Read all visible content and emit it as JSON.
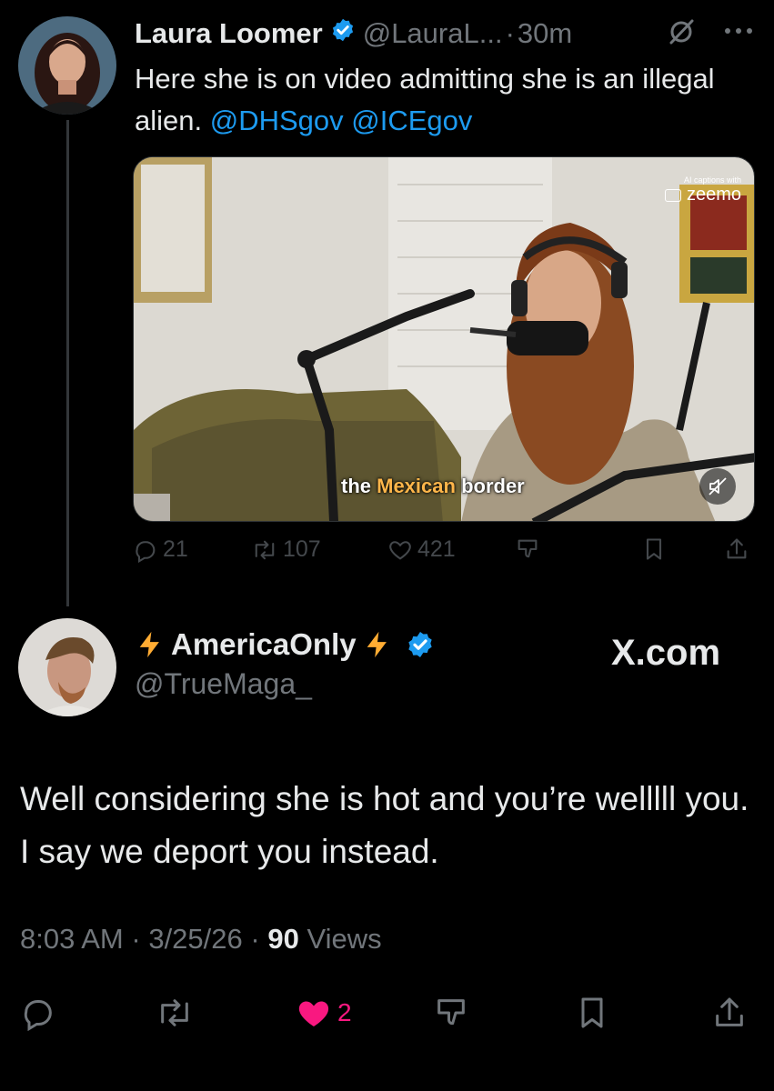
{
  "tweet1": {
    "author_name": "Laura Loomer",
    "handle": "@LauraL...",
    "separator": "·",
    "time": "30m",
    "text_plain": "Here she is on video admitting she is an illegal alien. ",
    "mention1": "@DHSgov",
    "mention2": "@ICEgov",
    "media": {
      "caption_pre": "the ",
      "caption_highlight": "Mexican",
      "caption_post": " border",
      "watermark_small": "AI captions with",
      "watermark_brand": "zeemo"
    },
    "stats": {
      "replies": "21",
      "reposts": "107",
      "likes": "421"
    }
  },
  "tweet2": {
    "author_name": "AmericaOnly",
    "handle": "@TrueMaga_",
    "brand": "X.com",
    "text": "Well considering she is hot and you’re welllll you. I say we deport you instead.",
    "time": "8:03 AM",
    "date": "3/25/26",
    "separator": "·",
    "views_count": "90",
    "views_label": "Views",
    "likes": "2"
  },
  "icons": {
    "verified": "verified-badge-icon",
    "lightning": "lightning-icon",
    "grok": "grok-icon",
    "more": "more-icon",
    "reply": "reply-icon",
    "repost": "repost-icon",
    "like": "heart-icon",
    "share": "share-icon",
    "bookmark": "bookmark-icon",
    "dislike": "dislike-icon",
    "mute": "mute-icon"
  },
  "colors": {
    "background": "#000000",
    "link": "#1d9bf0",
    "like": "#f91880",
    "secondary_text": "#71767b",
    "verified": "#1d9bf0",
    "lightning": "#ffac33"
  }
}
